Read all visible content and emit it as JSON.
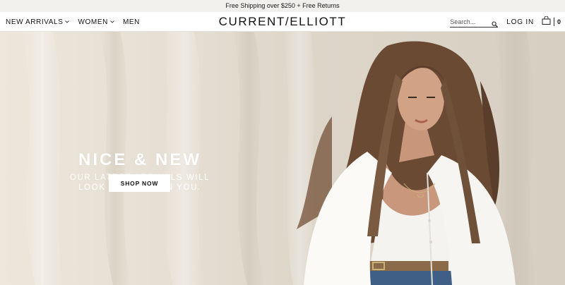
{
  "promo": {
    "text": "Free Shipping over $250 + Free Returns"
  },
  "header": {
    "nav": [
      {
        "label": "NEW ARRIVALS",
        "has_dropdown": true
      },
      {
        "label": "WOMEN",
        "has_dropdown": true
      },
      {
        "label": "MEN",
        "has_dropdown": false
      }
    ],
    "logo": "CURRENT/ELLIOTT",
    "search": {
      "placeholder": "Search...",
      "icon": "search-icon"
    },
    "login_label": "LOG IN",
    "bag": {
      "icon": "shopping-bag-icon",
      "count": "0"
    }
  },
  "hero": {
    "title": "NICE & NEW",
    "subtitle_line1": "OUR LATEST ARRIVALS WILL",
    "subtitle_line2": "LOOK SO GOOD ON YOU.",
    "cta_label": "SHOP NOW",
    "image": "model-in-white-shirt-photo"
  },
  "colors": {
    "promo_bg": "#f1f0ec",
    "hero_bg": "#e6dfd3",
    "text": "#111111",
    "hero_text": "#ffffff"
  }
}
